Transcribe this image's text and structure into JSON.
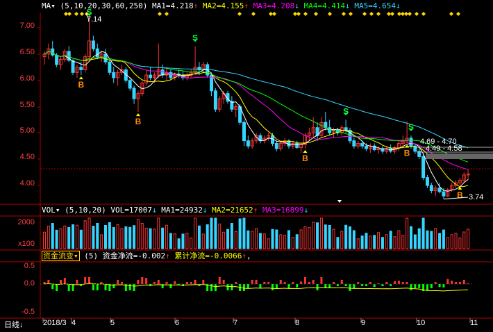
{
  "colors": {
    "background": "#000000",
    "axis_line": "#b00000",
    "price_label": "#ff4040",
    "vol_label": "#ff4040",
    "flow_label": "#ff4040",
    "up": "#ff3333",
    "down": "#36d4ff",
    "ma1": "#ffffff",
    "ma2": "#ffff00",
    "ma3": "#ff00ff",
    "ma4": "#00ff00",
    "ma5": "#36d4ff",
    "signal_b": "#ff8c00",
    "signal_s": "#00ff40",
    "marker_yellow": "#ffd700"
  },
  "price_panel": {
    "indicator": "MA",
    "params": "(5,10,20,30,60,250)",
    "ma1": "MA1=4.218",
    "ma2": "MA2=4.155",
    "ma3": "MA3=4.208",
    "ma4": "MA4=4.414",
    "ma5": "MA5=4.654",
    "y_ticks": [
      "7.00",
      "6.50",
      "6.00",
      "5.50",
      "5.00",
      "4.50",
      "4.00"
    ],
    "high_label": "7.14",
    "low_label": "3.74",
    "annotation_1": "4.69 - 4.70",
    "annotation_2": "4.49 - 4.58",
    "signal_b": "B",
    "signal_s": "S"
  },
  "volume_panel": {
    "indicator": "VOL",
    "params": "(5,10,20)",
    "vol": "VOL=17007",
    "ma1": "MA1=24932",
    "ma2": "MA2=21652",
    "ma3": "MA3=16899",
    "y_tick_top": "2000",
    "y_unit": "x100"
  },
  "flow_panel": {
    "indicator": "资金流变",
    "param": "(5)",
    "net": "资金净流=-0.002",
    "cumulative": "累计净流=-0.0066",
    "y_ticks": [
      "0.5",
      "0.0",
      "-0.5"
    ]
  },
  "bottom_bar": {
    "period": "日线",
    "x_labels": [
      "2018/3",
      "4",
      "5",
      "6",
      "7",
      "8",
      "9",
      "10",
      "11"
    ]
  },
  "chart_data": {
    "type": "candlestick",
    "period": "daily",
    "y_range": [
      3.7,
      7.3
    ],
    "month_labels": [
      "2018/3",
      "4",
      "5",
      "6",
      "7",
      "8",
      "9",
      "10",
      "11"
    ],
    "marked_high": 7.14,
    "marked_low": 3.74,
    "ma_latest": {
      "MA1": 4.218,
      "MA2": 4.155,
      "MA3": 4.208,
      "MA4": 4.414,
      "MA5": 4.654
    },
    "volume_latest": {
      "VOL": 17007,
      "MA1": 24932,
      "MA2": 21652,
      "MA3": 16899
    },
    "flow_latest": {
      "资金净流": -0.002,
      "累计净流": -0.0066
    },
    "candles": [
      [
        6.45,
        6.55,
        6.3,
        6.5
      ],
      [
        6.5,
        6.7,
        6.4,
        6.6
      ],
      [
        6.6,
        6.75,
        6.45,
        6.48
      ],
      [
        6.48,
        6.52,
        6.25,
        6.3
      ],
      [
        6.3,
        6.45,
        6.2,
        6.4
      ],
      [
        6.4,
        6.6,
        6.35,
        6.55
      ],
      [
        6.55,
        6.65,
        6.35,
        6.38
      ],
      [
        6.38,
        6.4,
        6.1,
        6.15
      ],
      [
        6.15,
        6.3,
        6.05,
        6.25
      ],
      [
        6.25,
        6.35,
        6.1,
        6.2
      ],
      [
        6.2,
        6.5,
        6.15,
        6.45
      ],
      [
        6.45,
        7.14,
        6.4,
        6.75
      ],
      [
        6.75,
        6.85,
        6.55,
        6.6
      ],
      [
        6.6,
        6.7,
        6.4,
        6.45
      ],
      [
        6.45,
        6.55,
        6.35,
        6.5
      ],
      [
        6.5,
        6.6,
        6.3,
        6.35
      ],
      [
        6.35,
        6.4,
        6.1,
        6.15
      ],
      [
        6.15,
        6.25,
        5.95,
        6.05
      ],
      [
        6.05,
        6.2,
        5.9,
        6.15
      ],
      [
        6.15,
        6.3,
        6.1,
        6.2
      ],
      [
        6.2,
        6.25,
        5.95,
        6.0
      ],
      [
        6.0,
        6.05,
        5.8,
        5.85
      ],
      [
        5.85,
        5.9,
        5.55,
        5.65
      ],
      [
        5.65,
        5.8,
        5.4,
        5.75
      ],
      [
        5.75,
        6.0,
        5.7,
        5.95
      ],
      [
        5.95,
        6.2,
        5.9,
        6.1
      ],
      [
        6.1,
        6.25,
        6.0,
        6.05
      ],
      [
        6.05,
        6.15,
        5.95,
        6.1
      ],
      [
        6.1,
        6.7,
        6.05,
        6.2
      ],
      [
        6.2,
        6.3,
        6.05,
        6.1
      ],
      [
        6.1,
        6.25,
        6.0,
        6.15
      ],
      [
        6.15,
        6.2,
        6.0,
        6.05
      ],
      [
        6.05,
        6.15,
        6.0,
        6.12
      ],
      [
        6.12,
        6.2,
        6.05,
        6.1
      ],
      [
        6.1,
        6.18,
        6.0,
        6.05
      ],
      [
        6.05,
        6.15,
        6.0,
        6.1
      ],
      [
        6.1,
        6.2,
        6.05,
        6.15
      ],
      [
        6.15,
        6.65,
        6.1,
        6.25
      ],
      [
        6.25,
        6.35,
        6.1,
        6.2
      ],
      [
        6.2,
        6.35,
        6.15,
        6.3
      ],
      [
        6.3,
        6.35,
        6.05,
        6.1
      ],
      [
        6.1,
        6.15,
        5.7,
        5.8
      ],
      [
        5.8,
        5.85,
        5.4,
        5.45
      ],
      [
        5.45,
        5.7,
        5.4,
        5.65
      ],
      [
        5.65,
        5.8,
        5.55,
        5.75
      ],
      [
        5.75,
        5.8,
        5.55,
        5.6
      ],
      [
        5.6,
        5.7,
        5.4,
        5.45
      ],
      [
        5.45,
        5.55,
        5.3,
        5.5
      ],
      [
        5.5,
        5.55,
        5.15,
        5.2
      ],
      [
        5.2,
        5.25,
        4.75,
        4.85
      ],
      [
        4.85,
        4.95,
        4.7,
        4.75
      ],
      [
        4.75,
        4.9,
        4.7,
        4.85
      ],
      [
        4.85,
        5.0,
        4.8,
        4.95
      ],
      [
        4.95,
        5.0,
        4.8,
        4.85
      ],
      [
        4.85,
        4.95,
        4.8,
        4.9
      ],
      [
        4.9,
        5.0,
        4.85,
        4.95
      ],
      [
        4.95,
        5.0,
        4.75,
        4.8
      ],
      [
        4.8,
        4.85,
        4.65,
        4.7
      ],
      [
        4.7,
        4.85,
        4.65,
        4.8
      ],
      [
        4.8,
        4.9,
        4.75,
        4.85
      ],
      [
        4.85,
        4.88,
        4.7,
        4.75
      ],
      [
        4.75,
        4.85,
        4.7,
        4.8
      ],
      [
        4.8,
        4.85,
        4.7,
        4.72
      ],
      [
        4.72,
        4.8,
        4.62,
        4.78
      ],
      [
        4.78,
        5.0,
        4.7,
        4.95
      ],
      [
        4.95,
        5.1,
        4.85,
        5.0
      ],
      [
        5.0,
        5.3,
        4.9,
        5.1
      ],
      [
        5.1,
        5.2,
        4.85,
        4.95
      ],
      [
        4.95,
        5.3,
        4.9,
        5.2
      ],
      [
        5.2,
        5.4,
        5.05,
        5.1
      ],
      [
        5.1,
        5.25,
        4.95,
        5.0
      ],
      [
        5.0,
        5.1,
        4.9,
        5.05
      ],
      [
        5.05,
        5.1,
        4.95,
        5.0
      ],
      [
        5.0,
        5.15,
        4.95,
        5.1
      ],
      [
        5.1,
        5.25,
        5.0,
        5.05
      ],
      [
        5.05,
        5.1,
        4.8,
        4.85
      ],
      [
        4.85,
        4.9,
        4.7,
        4.75
      ],
      [
        4.75,
        4.85,
        4.7,
        4.8
      ],
      [
        4.8,
        4.85,
        4.7,
        4.75
      ],
      [
        4.75,
        4.8,
        4.65,
        4.7
      ],
      [
        4.7,
        4.8,
        4.62,
        4.75
      ],
      [
        4.75,
        4.8,
        4.65,
        4.68
      ],
      [
        4.68,
        4.75,
        4.6,
        4.7
      ],
      [
        4.7,
        4.75,
        4.6,
        4.65
      ],
      [
        4.65,
        4.75,
        4.6,
        4.7
      ],
      [
        4.7,
        4.78,
        4.62,
        4.65
      ],
      [
        4.65,
        4.75,
        4.6,
        4.72
      ],
      [
        4.72,
        4.85,
        4.65,
        4.8
      ],
      [
        4.8,
        4.95,
        4.75,
        4.85
      ],
      [
        4.85,
        5.22,
        4.8,
        4.9
      ],
      [
        4.9,
        4.95,
        4.7,
        4.75
      ],
      [
        4.75,
        4.8,
        4.6,
        4.65
      ],
      [
        4.65,
        4.75,
        4.5,
        4.55
      ],
      [
        4.55,
        4.6,
        4.1,
        4.15
      ],
      [
        4.15,
        4.2,
        3.95,
        4.0
      ],
      [
        4.0,
        4.05,
        3.85,
        3.9
      ],
      [
        3.9,
        4.0,
        3.8,
        3.95
      ],
      [
        3.95,
        4.05,
        3.85,
        3.88
      ],
      [
        3.88,
        3.95,
        3.74,
        3.8
      ],
      [
        3.8,
        3.95,
        3.78,
        3.92
      ],
      [
        3.92,
        4.05,
        3.88,
        4.0
      ],
      [
        4.0,
        4.1,
        3.95,
        4.05
      ],
      [
        4.05,
        4.15,
        4.0,
        4.1
      ],
      [
        4.1,
        4.25,
        4.05,
        4.2
      ],
      [
        4.2,
        4.3,
        4.1,
        4.22
      ]
    ]
  }
}
